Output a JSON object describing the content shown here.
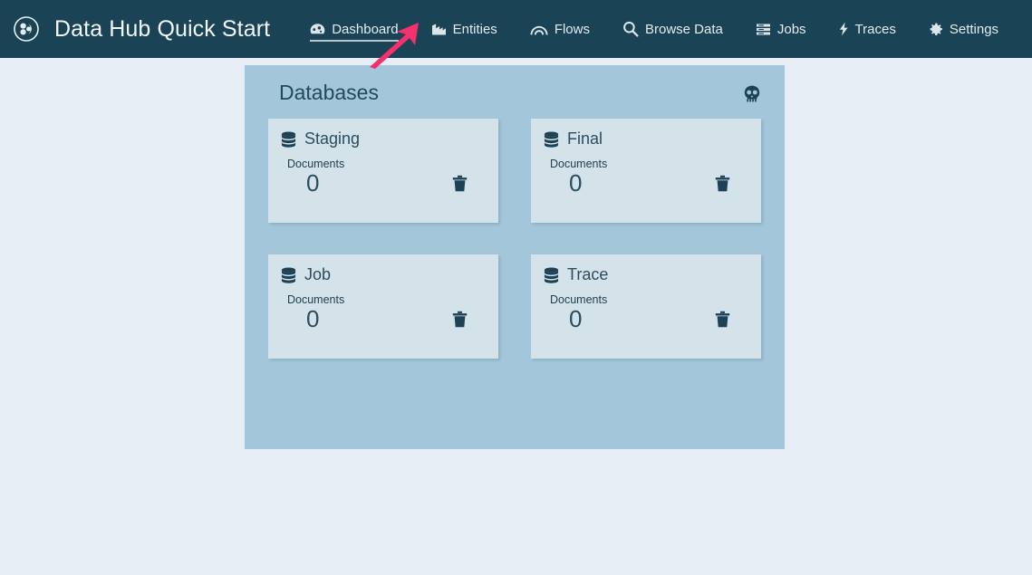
{
  "navbar": {
    "logo_icon": "marklogic-circle-logo",
    "brand_title": "Data Hub Quick Start",
    "items": [
      {
        "label": "Dashboard",
        "icon": "dashboard-gauge-icon",
        "active": true
      },
      {
        "label": "Entities",
        "icon": "entities-bar-chart-icon",
        "active": false
      },
      {
        "label": "Flows",
        "icon": "flows-arc-icon",
        "active": false
      },
      {
        "label": "Browse Data",
        "icon": "search-icon",
        "active": false
      },
      {
        "label": "Jobs",
        "icon": "jobs-server-list-icon",
        "active": false
      },
      {
        "label": "Traces",
        "icon": "traces-bolt-icon",
        "active": false
      },
      {
        "label": "Settings",
        "icon": "gear-icon",
        "active": false
      }
    ],
    "avatar_icon": "user-avatar-icon",
    "bg_color": "#1a4456",
    "text_color": "#e3ebee"
  },
  "annotation": {
    "type": "pointer-arrow",
    "color": "#f4306d",
    "points_to": "Entities"
  },
  "panel": {
    "title": "Databases",
    "skull_icon": "skull-icon",
    "bg_color": "#a3c6da",
    "card_bg_color": "#d4e2ea",
    "cards": [
      {
        "name": "Staging",
        "icon": "database-stack-icon",
        "metric_label": "Documents",
        "count": "0",
        "delete_icon": "trash-icon"
      },
      {
        "name": "Final",
        "icon": "database-stack-icon",
        "metric_label": "Documents",
        "count": "0",
        "delete_icon": "trash-icon"
      },
      {
        "name": "Job",
        "icon": "database-stack-icon",
        "metric_label": "Documents",
        "count": "0",
        "delete_icon": "trash-icon"
      },
      {
        "name": "Trace",
        "icon": "database-stack-icon",
        "metric_label": "Documents",
        "count": "0",
        "delete_icon": "trash-icon"
      }
    ]
  },
  "page": {
    "bg_color": "#e8eef5"
  }
}
